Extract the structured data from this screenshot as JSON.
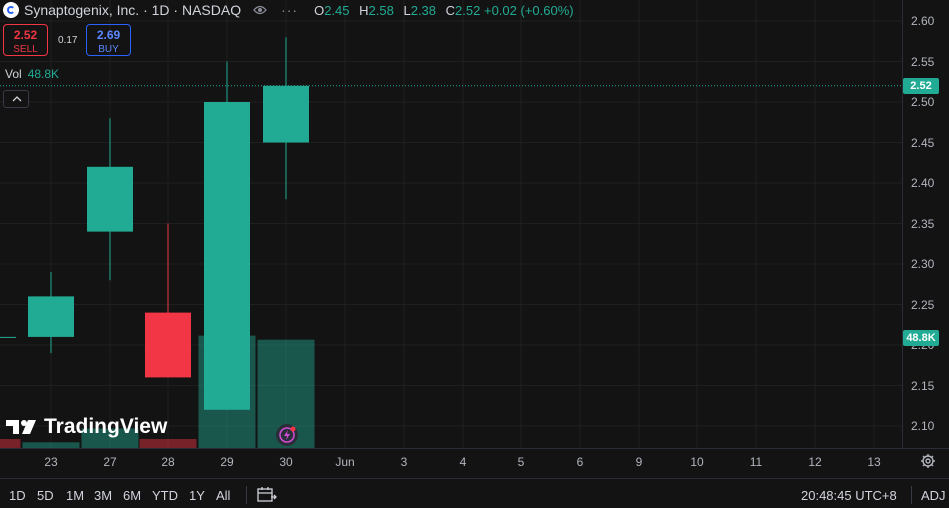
{
  "header": {
    "title": "Synaptogenix, Inc. · 1D · NASDAQ",
    "ohlc": {
      "o_label": "O",
      "o": "2.45",
      "h_label": "H",
      "h": "2.58",
      "l_label": "L",
      "l": "2.38",
      "c_label": "C",
      "c": "2.52",
      "change": "+0.02 (+0.60%)"
    }
  },
  "trade": {
    "sell_price": "2.52",
    "sell_label": "SELL",
    "spread": "0.17",
    "buy_price": "2.69",
    "buy_label": "BUY"
  },
  "volume": {
    "label": "Vol",
    "value": "48.8K"
  },
  "price_axis": {
    "ticks": [
      "2.60",
      "2.55",
      "2.50",
      "2.45",
      "2.40",
      "2.35",
      "2.30",
      "2.25",
      "2.20",
      "2.15",
      "2.10"
    ],
    "last_price_label": "2.52",
    "volume_label": "48.8K"
  },
  "time_axis": [
    "23",
    "27",
    "28",
    "29",
    "30",
    "Jun",
    "3",
    "4",
    "5",
    "6",
    "9",
    "10",
    "11",
    "12",
    "13"
  ],
  "watermark": "TradingView",
  "toolbar": {
    "ranges": [
      "1D",
      "5D",
      "1M",
      "3M",
      "6M",
      "YTD",
      "1Y",
      "All"
    ],
    "clock": "20:48:45 UTC+8",
    "adj": "ADJ"
  },
  "colors": {
    "up": "#22ab94",
    "down": "#f23645",
    "background": "#131313",
    "grid": "#1f1f1f"
  },
  "icons": [
    "eye-icon",
    "more-icon",
    "collapse-icon",
    "settings-gear-icon",
    "calendar-range-icon",
    "flash-icon"
  ],
  "chart_data": {
    "type": "candlestick",
    "x_ticks": [
      "23",
      "27",
      "28",
      "29",
      "30",
      "Jun",
      "3",
      "4",
      "5",
      "6",
      "9",
      "10",
      "11",
      "12",
      "13"
    ],
    "y_range": [
      2.075,
      2.625
    ],
    "last_price": 2.52,
    "candles": [
      {
        "date": "22",
        "open": 2.21,
        "high": 2.21,
        "low": 2.21,
        "close": 2.21,
        "direction": "up",
        "partial": true
      },
      {
        "date": "23",
        "open": 2.21,
        "high": 2.29,
        "low": 2.19,
        "close": 2.26,
        "direction": "up"
      },
      {
        "date": "27",
        "open": 2.34,
        "high": 2.48,
        "low": 2.28,
        "close": 2.42,
        "direction": "up"
      },
      {
        "date": "28",
        "open": 2.24,
        "high": 2.35,
        "low": 2.16,
        "close": 2.16,
        "direction": "down"
      },
      {
        "date": "29",
        "open": 2.12,
        "high": 2.55,
        "low": 2.12,
        "close": 2.5,
        "direction": "up"
      },
      {
        "date": "30",
        "open": 2.45,
        "high": 2.58,
        "low": 2.38,
        "close": 2.52,
        "direction": "up"
      }
    ],
    "volume_series": [
      {
        "date": "22",
        "value": 11,
        "direction": "down"
      },
      {
        "date": "23",
        "value": 7,
        "direction": "up"
      },
      {
        "date": "27",
        "value": 24,
        "direction": "up"
      },
      {
        "date": "28",
        "value": 11,
        "direction": "down"
      },
      {
        "date": "29",
        "value": 138,
        "direction": "up"
      },
      {
        "date": "30",
        "value": 133,
        "direction": "up"
      }
    ]
  }
}
